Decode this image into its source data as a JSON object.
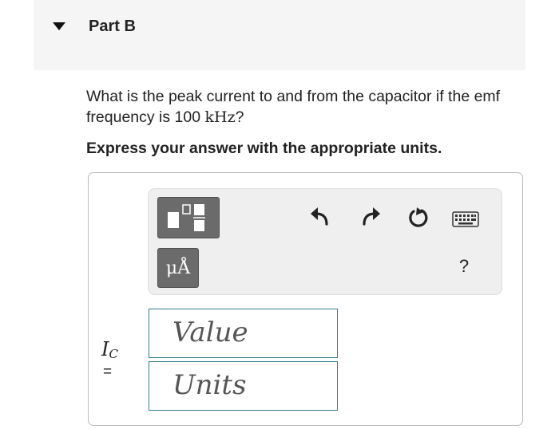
{
  "part": {
    "title": "Part B",
    "toggle_icon": "caret-down-icon"
  },
  "question": {
    "text_before": "What is the peak current to and from the capacitor if the emf frequency is 100 ",
    "unit": "kHz",
    "text_after": "?"
  },
  "instruction": "Express your answer with the appropriate units.",
  "toolbar": {
    "templates_icon": "templates-icon",
    "units_label": "μÅ",
    "undo_icon": "undo-icon",
    "redo_icon": "redo-icon",
    "reset_icon": "reset-icon",
    "keyboard_icon": "keyboard-icon",
    "help_label": "?"
  },
  "answer": {
    "variable": "I",
    "subscript": "C",
    "equals": "=",
    "value_placeholder": "Value",
    "units_placeholder": "Units"
  },
  "colors": {
    "field_border": "#2e7d8a",
    "button_bg": "#6b6b6b",
    "toolbar_bg": "#efefef"
  }
}
